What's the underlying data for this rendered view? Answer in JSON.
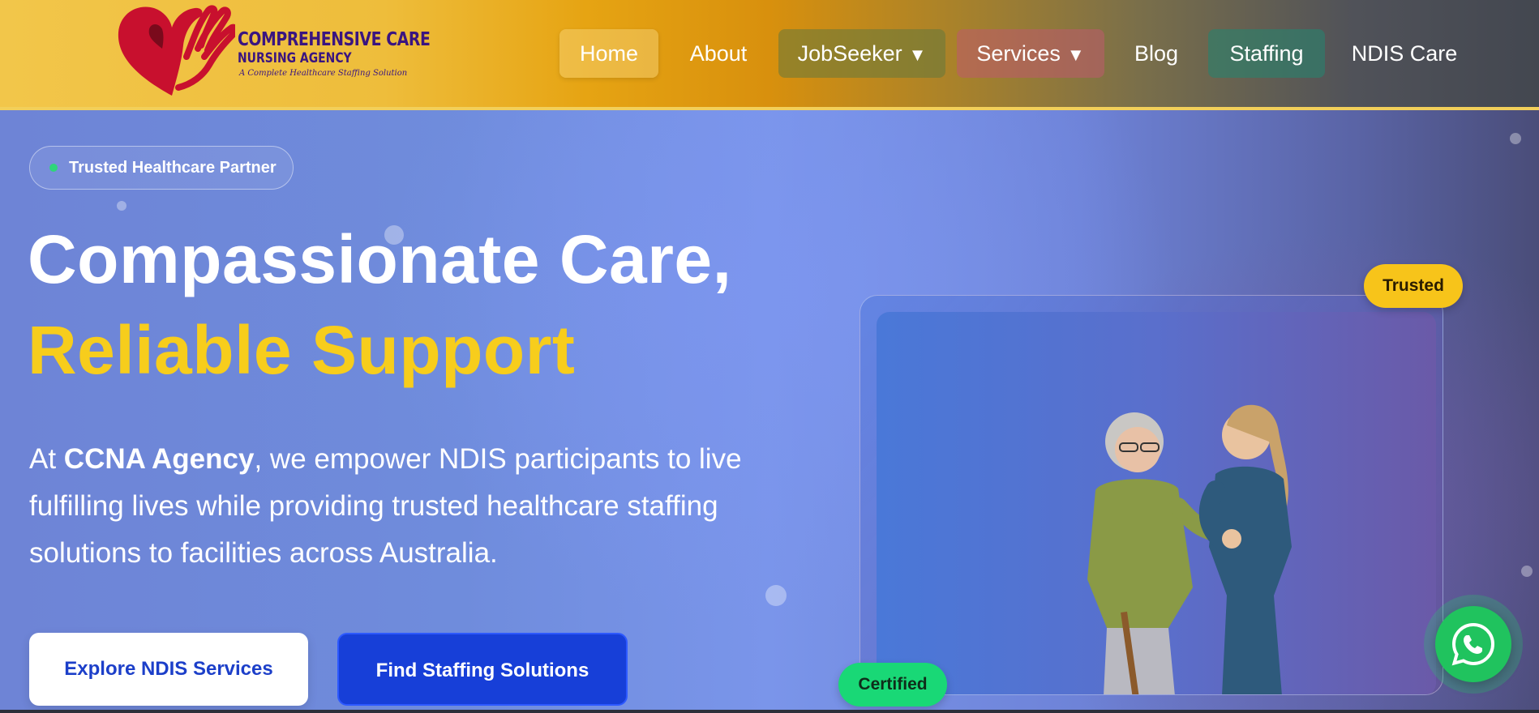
{
  "header": {
    "logo": {
      "title": "COMPREHENSIVE CARE",
      "subtitle": "NURSING AGENCY",
      "tagline": "A Complete Healthcare Staffing Solution",
      "icon": "heart-hands-icon"
    },
    "nav": [
      {
        "label": "Home",
        "active": true
      },
      {
        "label": "About"
      },
      {
        "label": "JobSeeker",
        "caret": "▼"
      },
      {
        "label": "Services",
        "caret": "▼"
      },
      {
        "label": "Blog"
      },
      {
        "label": "Staffing"
      },
      {
        "label": "NDIS Care"
      }
    ]
  },
  "hero": {
    "pill": "Trusted Healthcare Partner",
    "headline_line1": "Compassionate Care,",
    "headline_line2": "Reliable Support",
    "description": {
      "prefix": "At ",
      "brand": "CCNA Agency",
      "rest": ", we empower NDIS participants to live fulfilling lives while providing trusted healthcare staffing solutions to facilities across Australia."
    },
    "cta_primary": "Explore NDIS Services",
    "cta_secondary": "Find Staffing Solutions",
    "badge_trusted": "Trusted",
    "badge_certified": "Certified",
    "whatsapp_icon": "whatsapp-icon"
  },
  "colors": {
    "accent_yellow": "#f7cd1c",
    "primary_blue": "#173fd8",
    "certified_green": "#19d876",
    "logo_purple": "#3a1580"
  }
}
